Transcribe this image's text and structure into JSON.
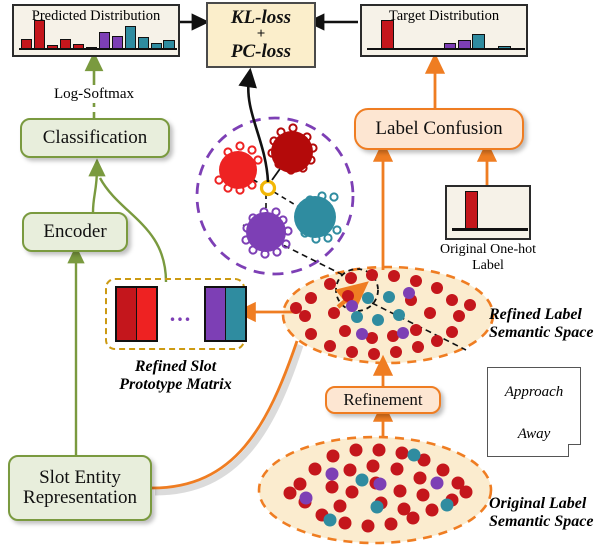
{
  "diagram": {
    "title": "Label Confusion / Slot Prototype Refinement Architecture"
  },
  "boxes": {
    "predicted_distribution": "Predicted Distribution",
    "target_distribution": "Target Distribution",
    "loss_line1": "KL-loss",
    "loss_plus": "+",
    "loss_line2": "PC-loss",
    "log_softmax": "Log-Softmax",
    "classification": "Classification",
    "encoder": "Encoder",
    "label_confusion": "Label Confusion",
    "refinement": "Refinement",
    "slot_entity": "Slot Entity\nRepresentation",
    "slot_entity_l1": "Slot Entity",
    "slot_entity_l2": "Representation",
    "onehot_caption_l1": "Original One-hot",
    "onehot_caption_l2": "Label",
    "prototype_caption_l1": "Refined Slot",
    "prototype_caption_l2": "Prototype Matrix",
    "refined_space_l1": "Refined Label",
    "refined_space_l2": "Semantic Space",
    "original_space_l1": "Original Label",
    "original_space_l2": "Semantic Space"
  },
  "legend": {
    "approach": "Approach",
    "away": "Away"
  },
  "colors": {
    "red_dark": "#c4161c",
    "red_bright": "#ee2222",
    "purple": "#7d3fb5",
    "teal": "#2f8ca0",
    "orange": "#ef7d22",
    "green": "#7a9a3f",
    "gold": "#f2b705",
    "dashed_purple": "#7d3fb5",
    "ellipse_fill": "#fbeccf",
    "panel_cream": "#f6f2e8",
    "loss_fill": "#fbeecb"
  },
  "chart_data": [
    {
      "type": "bar",
      "title": "Predicted Distribution",
      "categories": [
        "1",
        "2",
        "3",
        "4",
        "5",
        "6",
        "7",
        "8",
        "9",
        "10",
        "11",
        "12"
      ],
      "values": [
        0.3,
        0.92,
        0.1,
        0.3,
        0.14,
        0.05,
        0.55,
        0.4,
        0.72,
        0.38,
        0.16,
        0.28
      ],
      "bar_colors": [
        "#c4161c",
        "#c4161c",
        "#c4161c",
        "#c4161c",
        "#c4161c",
        "#c4161c",
        "#7d3fb5",
        "#7d3fb5",
        "#2f8ca0",
        "#2f8ca0",
        "#2f8ca0",
        "#2f8ca0"
      ],
      "xlabel": "",
      "ylabel": "",
      "ylim": [
        0,
        1
      ],
      "grid": false,
      "legend": "none"
    },
    {
      "type": "bar",
      "title": "Target Distribution",
      "categories": [
        "1",
        "2",
        "3",
        "4",
        "5",
        "6",
        "7",
        "8",
        "9",
        "10",
        "11",
        "12"
      ],
      "values": [
        0.0,
        0.95,
        0.0,
        0.0,
        0.0,
        0.0,
        0.18,
        0.28,
        0.46,
        0.0,
        0.08,
        0.0
      ],
      "bar_colors": [
        "#c4161c",
        "#c4161c",
        "#c4161c",
        "#c4161c",
        "#c4161c",
        "#c4161c",
        "#7d3fb5",
        "#7d3fb5",
        "#2f8ca0",
        "#2f8ca0",
        "#2f8ca0",
        "#2f8ca0"
      ],
      "xlabel": "",
      "ylabel": "",
      "ylim": [
        0,
        1
      ],
      "grid": false,
      "legend": "none"
    },
    {
      "type": "bar",
      "title": "Original One-hot Label",
      "categories": [
        "1",
        "2",
        "3",
        "4",
        "5",
        "6"
      ],
      "values": [
        0.0,
        1.0,
        0.0,
        0.0,
        0.0,
        0.0
      ],
      "bar_colors": [
        "#c4161c",
        "#c4161c",
        "#c4161c",
        "#c4161c",
        "#c4161c",
        "#c4161c"
      ],
      "xlabel": "",
      "ylabel": "",
      "ylim": [
        0,
        1
      ],
      "grid": false,
      "legend": "none"
    }
  ],
  "prototype_matrix": {
    "columns": [
      "#c4161c",
      "#ee2222",
      "#7d3fb5",
      "#2f8ca0"
    ],
    "ellipsis": "..."
  },
  "cluster_view": {
    "prototypes": [
      {
        "color": "#ee2222",
        "label": "bright-red-prototype"
      },
      {
        "color": "#b40a0a",
        "label": "dark-red-prototype"
      },
      {
        "color": "#7d3fb5",
        "label": "purple-prototype"
      },
      {
        "color": "#2f8ca0",
        "label": "teal-prototype"
      }
    ],
    "center_marker": "#f2b705"
  }
}
